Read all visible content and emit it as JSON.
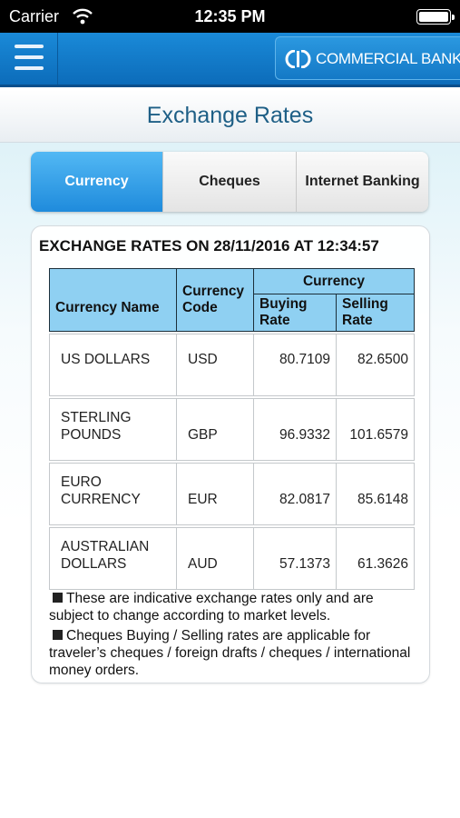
{
  "status_bar": {
    "carrier": "Carrier",
    "time": "12:35 PM"
  },
  "header": {
    "brand": "COMMERCIAL BANK"
  },
  "page": {
    "title": "Exchange Rates"
  },
  "tabs": [
    {
      "label": "Currency",
      "active": true
    },
    {
      "label": "Cheques",
      "active": false
    },
    {
      "label": "Internet Banking",
      "active": false
    }
  ],
  "panel": {
    "heading": "EXCHANGE RATES ON 28/11/2016 AT 12:34:57",
    "table": {
      "headers": {
        "currency_name": "Currency Name",
        "currency_code": "Currency Code",
        "group": "Currency",
        "buying_rate": "Buying Rate",
        "selling_rate": "Selling Rate"
      },
      "rows": [
        {
          "name": "US DOLLARS",
          "code": "USD",
          "buying": "80.7109",
          "selling": "82.6500"
        },
        {
          "name": "STERLING POUNDS",
          "code": "GBP",
          "buying": "96.9332",
          "selling": "101.6579"
        },
        {
          "name": "EURO CURRENCY",
          "code": "EUR",
          "buying": "82.0817",
          "selling": "85.6148"
        },
        {
          "name": "AUSTRALIAN DOLLARS",
          "code": "AUD",
          "buying": "57.1373",
          "selling": "61.3626"
        }
      ]
    },
    "notes": [
      "These are indicative exchange rates only and are subject to change according to market levels.",
      "Cheques Buying / Selling rates are applicable for traveler’s cheques / foreign drafts / cheques / international money orders."
    ]
  },
  "colors": {
    "header_blue": "#0c6cba",
    "tab_active": "#1f8bdc",
    "table_header": "#8fd0f2",
    "title_text": "#1e5f86"
  }
}
